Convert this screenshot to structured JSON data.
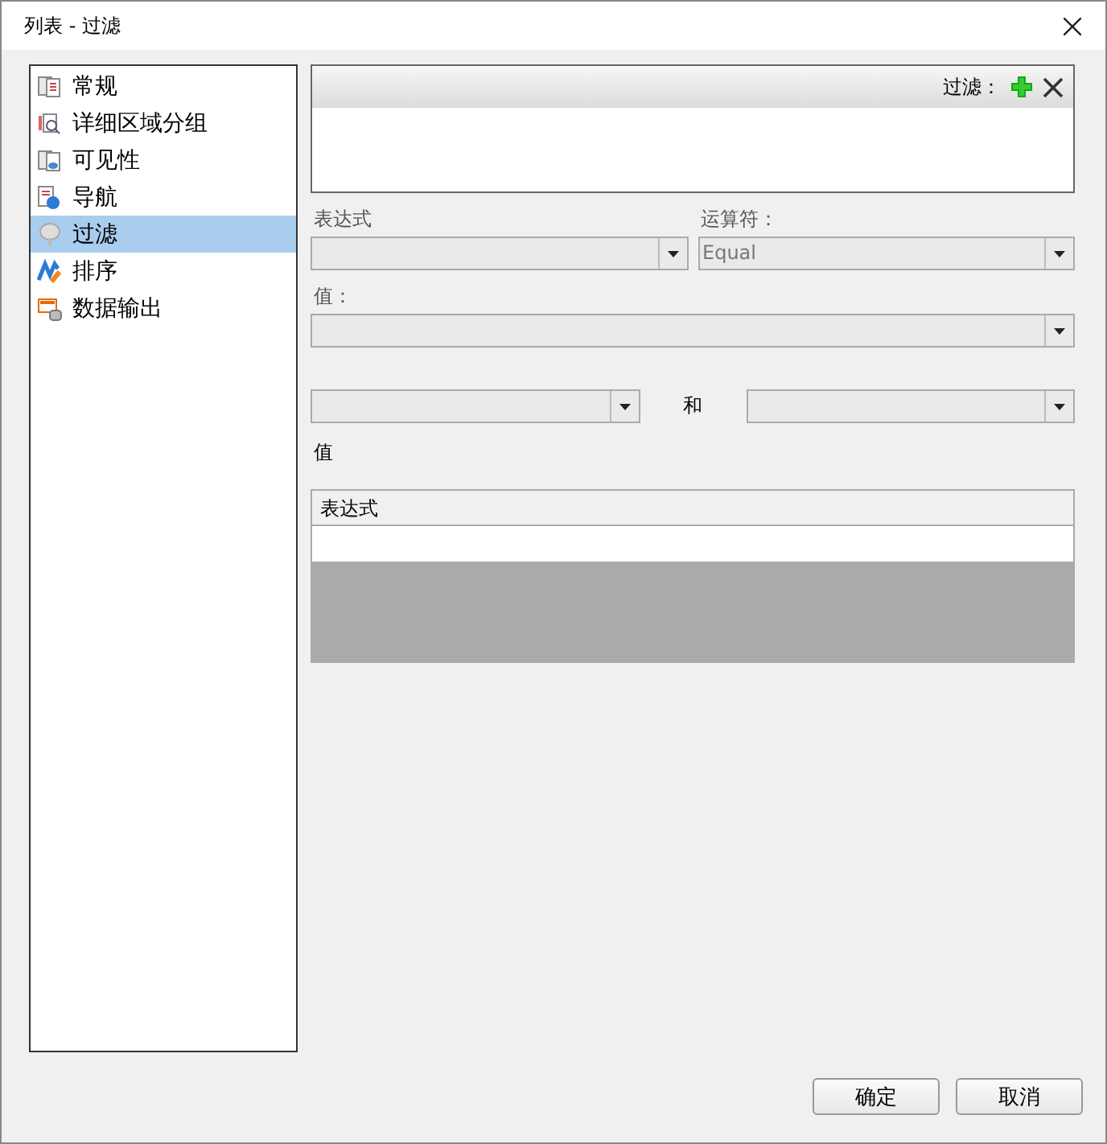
{
  "window": {
    "title": "列表 - 过滤"
  },
  "sidebar": {
    "items": [
      {
        "label": "常规",
        "selected": false
      },
      {
        "label": "详细区域分组",
        "selected": false
      },
      {
        "label": "可见性",
        "selected": false
      },
      {
        "label": "导航",
        "selected": false
      },
      {
        "label": "过滤",
        "selected": true
      },
      {
        "label": "排序",
        "selected": false
      },
      {
        "label": "数据输出",
        "selected": false
      }
    ]
  },
  "filter_list": {
    "header": "过滤："
  },
  "expression": {
    "label": "表达式"
  },
  "operator": {
    "label": "运算符：",
    "value": "Equal",
    "disabled": true
  },
  "value": {
    "label": "值："
  },
  "range": {
    "separator": "和"
  },
  "values": {
    "label": "值",
    "columns": [
      "表达式"
    ]
  },
  "buttons": [
    "确定",
    "取消"
  ]
}
